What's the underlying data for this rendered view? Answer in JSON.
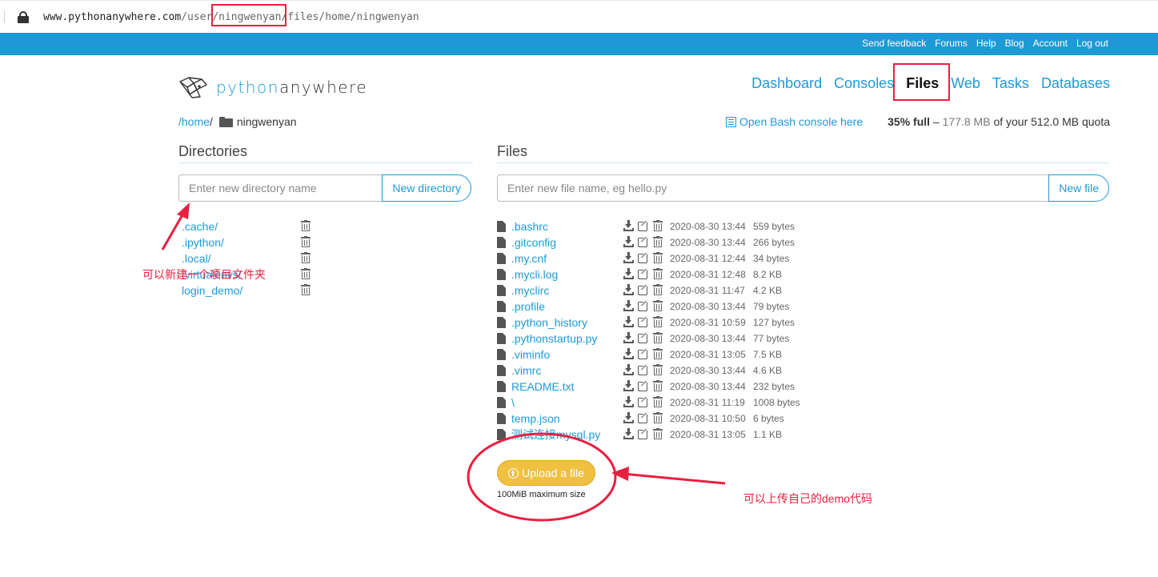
{
  "browser": {
    "url_host": "www.pythonanywhere.com",
    "url_path_prefix": "/user",
    "url_user": "/ningwenyan",
    "url_path_suffix": "/files/home/ningwenyan"
  },
  "topbar": {
    "links": [
      "Send feedback",
      "Forums",
      "Help",
      "Blog",
      "Account",
      "Log out"
    ]
  },
  "logo": {
    "part1": "python",
    "part2": "anywhere"
  },
  "nav": {
    "items": [
      {
        "label": "Dashboard",
        "active": false
      },
      {
        "label": "Consoles",
        "active": false
      },
      {
        "label": "Files",
        "active": true
      },
      {
        "label": "Web",
        "active": false
      },
      {
        "label": "Tasks",
        "active": false
      },
      {
        "label": "Databases",
        "active": false
      }
    ]
  },
  "breadcrumb": {
    "home": "/home",
    "sep": "/",
    "current": "ningwenyan"
  },
  "bash_link": "Open Bash console here",
  "quota": {
    "percent": "35% full",
    "dash": " – ",
    "used": "177.8 MB",
    "rest": " of your 512.0 MB quota"
  },
  "directories": {
    "title": "Directories",
    "placeholder": "Enter new directory name",
    "button": "New directory",
    "items": [
      ".cache/",
      ".ipython/",
      ".local/",
      ".virtualenvs/",
      "login_demo/"
    ]
  },
  "files": {
    "title": "Files",
    "placeholder": "Enter new file name, eg hello.py",
    "button": "New file",
    "items": [
      {
        "name": ".bashrc",
        "date": "2020-08-30 13:44",
        "size": "559 bytes"
      },
      {
        "name": ".gitconfig",
        "date": "2020-08-30 13:44",
        "size": "266 bytes"
      },
      {
        "name": ".my.cnf",
        "date": "2020-08-31 12:44",
        "size": "34 bytes"
      },
      {
        "name": ".mycli.log",
        "date": "2020-08-31 12:48",
        "size": "8.2 KB"
      },
      {
        "name": ".myclirc",
        "date": "2020-08-31 11:47",
        "size": "4.2 KB"
      },
      {
        "name": ".profile",
        "date": "2020-08-30 13:44",
        "size": "79 bytes"
      },
      {
        "name": ".python_history",
        "date": "2020-08-31 10:59",
        "size": "127 bytes"
      },
      {
        "name": ".pythonstartup.py",
        "date": "2020-08-30 13:44",
        "size": "77 bytes"
      },
      {
        "name": ".viminfo",
        "date": "2020-08-31 13:05",
        "size": "7.5 KB"
      },
      {
        "name": ".vimrc",
        "date": "2020-08-30 13:44",
        "size": "4.6 KB"
      },
      {
        "name": "README.txt",
        "date": "2020-08-30 13:44",
        "size": "232 bytes"
      },
      {
        "name": "\\",
        "date": "2020-08-31 11:19",
        "size": "1008 bytes"
      },
      {
        "name": "temp.json",
        "date": "2020-08-31 10:50",
        "size": "6 bytes"
      },
      {
        "name": "测试连接mysql.py",
        "date": "2020-08-31 13:05",
        "size": "1.1 KB"
      }
    ],
    "upload_label": "Upload a file",
    "upload_note": "100MiB maximum size"
  },
  "annotations": {
    "dir_note": "可以新建一个项目文件夹",
    "upload_note": "可以上传自己的demo代码",
    "color": "#e8203f"
  },
  "colors": {
    "brand": "#1d9ad6",
    "upload": "#f0c040"
  }
}
